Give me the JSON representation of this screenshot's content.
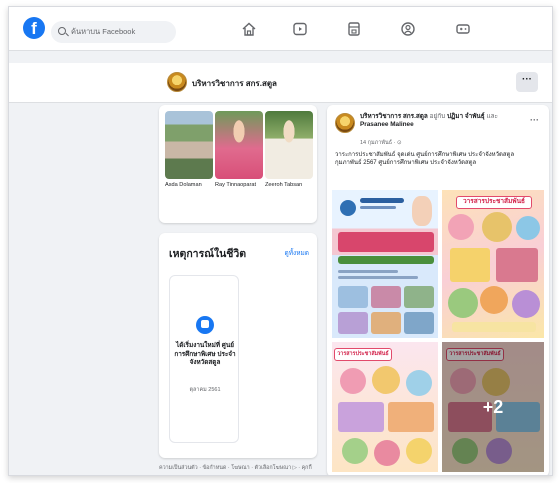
{
  "topbar": {
    "logo_letter": "f",
    "search_placeholder": "ค้นหาบน Facebook",
    "nav_icons": [
      "home-icon",
      "video-icon",
      "marketplace-icon",
      "groups-icon",
      "gaming-icon"
    ]
  },
  "profile": {
    "name": "บริหารวิชาการ สกร.สตูล",
    "more_label": "···"
  },
  "friends": [
    {
      "name": "Asda Dolaman"
    },
    {
      "name": "Ray Tinnaoparat"
    },
    {
      "name": "Zeeroh Tabsan"
    }
  ],
  "life_events": {
    "title": "เหตุการณ์ในชีวิต",
    "see_all": "ดูทั้งหมด",
    "item_text": "ได้เริ่มงานใหม่ที่ ศูนย์การศึกษาพิเศษ ประจำจังหวัดสตูล",
    "item_date": "ตุลาคม 2561"
  },
  "footer": "ความเป็นส่วนตัว · ข้อกำหนด · โฆษณา · ตัวเลือกโฆษณา ▷ · คุกกี้",
  "post": {
    "author": "บริหารวิชาการ สกร.สตูล",
    "with_text": "อยู่กับ",
    "tagged_1": "ปฏิมา จำพันธุ์",
    "and_text": "และ",
    "tagged_2": "Prasanee Malinee",
    "date": "14 กุมภาพันธ์ · ⊙",
    "dots": "···",
    "body": "วาระการประชาสัมพันธ์ จุดเด่น ศูนย์การศึกษาพิเศษ ประจำจังหวัดสตูล กุมภาพันธ์ 2567 ศูนย์การศึกษาพิเศษ ประจำจังหวัดสตูล",
    "banner_1": "วารสารประชาสัมพันธ์",
    "banner_2": "วารสารประชาสัมพันธ์",
    "banner_3": "วารสารประชาสัมพันธ์",
    "more_photos": "+2"
  }
}
